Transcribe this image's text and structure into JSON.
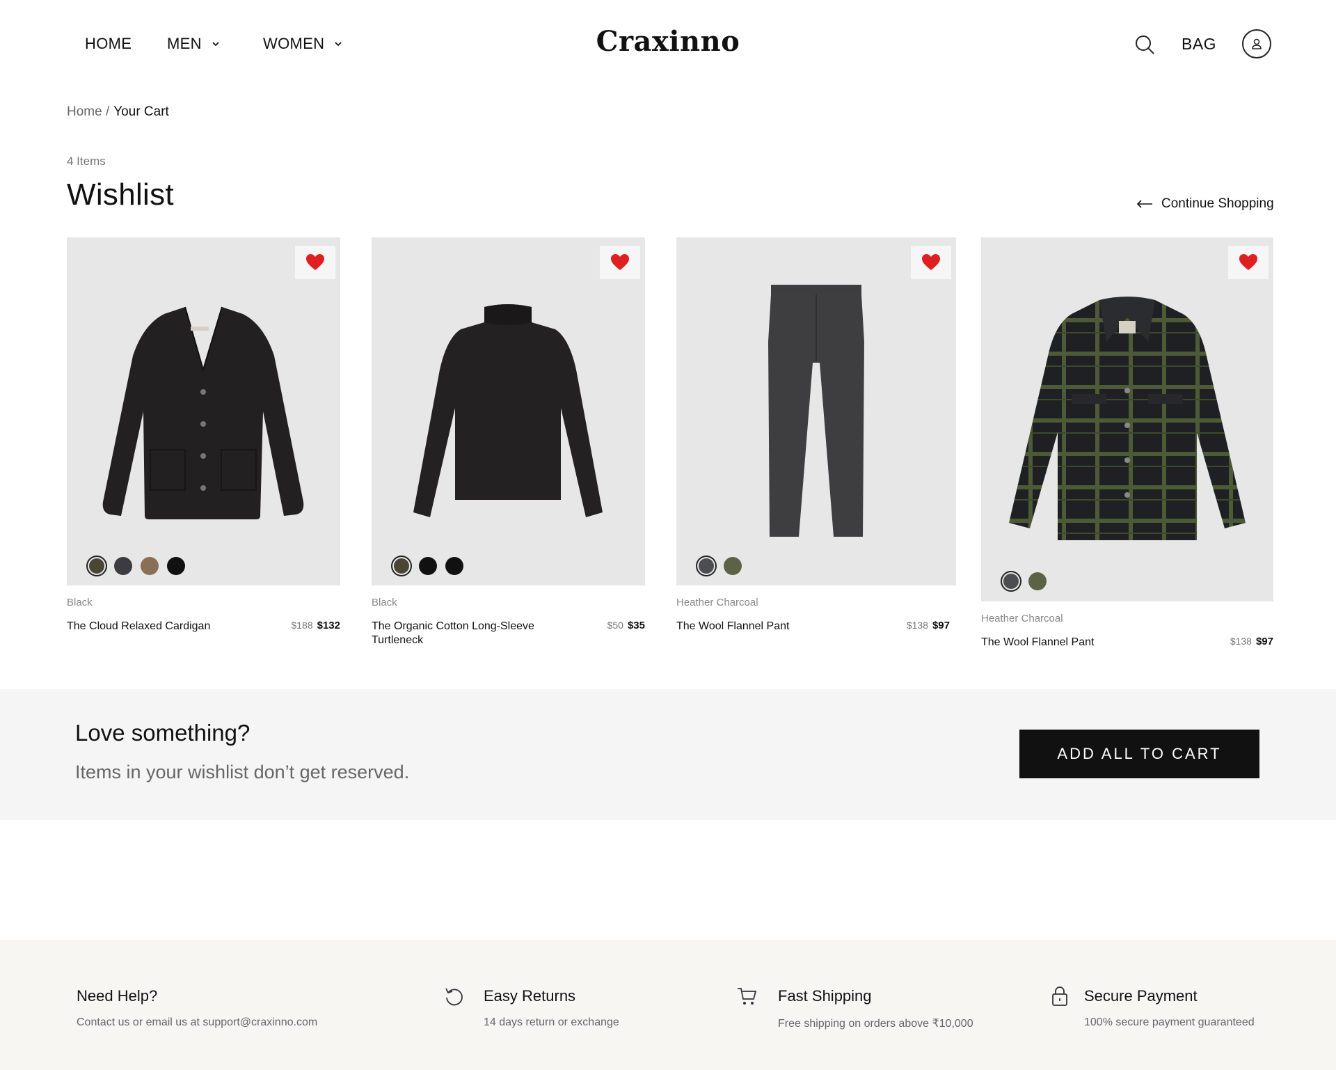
{
  "nav": {
    "home": "HOME",
    "men": "MEN",
    "women": "WOMEN",
    "brand": "Craxinno",
    "bag": "BAG"
  },
  "breadcrumb": {
    "home": "Home /",
    "current": "Your Cart"
  },
  "wishlist": {
    "count": "4 Items",
    "title": "Wishlist",
    "continue": "Continue Shopping"
  },
  "products": [
    {
      "color_name": "Black",
      "name": "The Cloud Relaxed Cardigan",
      "price_old": "$188",
      "price_new": "$132",
      "swatches": [
        "#4a4535",
        "#3b3b41",
        "#8a6f57",
        "#111111"
      ],
      "image": "black cardigan"
    },
    {
      "color_name": "Black",
      "name": "The Organic Cotton Long-Sleeve Turtleneck",
      "price_old": "$50",
      "price_new": "$35",
      "swatches": [
        "#4a4535",
        "#111111",
        "#111111"
      ],
      "image": "black turtleneck"
    },
    {
      "color_name": "Heather Charcoal",
      "name": "The Wool Flannel Pant",
      "price_old": "$138",
      "price_new": "$97",
      "swatches": [
        "#4b4d50",
        "#5c6345"
      ],
      "image": "charcoal pant"
    },
    {
      "color_name": "Heather Charcoal",
      "name": "The Wool Flannel Pant",
      "price_old": "$138",
      "price_new": "$97",
      "swatches": [
        "#4b4d50",
        "#5c6345"
      ],
      "image": "plaid shirt jacket"
    }
  ],
  "banner": {
    "title": "Love something?",
    "subtitle": "Items in your wishlist don’t get reserved.",
    "button": "ADD ALL TO CART"
  },
  "footer": {
    "help_title": "Need Help?",
    "help_desc": "Contact us or email us at support@craxinno.com",
    "returns_title": "Easy Returns",
    "returns_desc": "14 days return or exchange",
    "shipping_title": "Fast Shipping",
    "shipping_desc": "Free shipping on orders above ₹10,000",
    "payment_title": "Secure Payment",
    "payment_desc": "100% secure payment guaranteed"
  },
  "colors": {
    "accent_heart": "#e02020",
    "button_bg": "#111111",
    "banner_bg": "#f5f5f5",
    "footer_bg": "#f7f6f3",
    "image_bg": "#e7e7e7"
  }
}
